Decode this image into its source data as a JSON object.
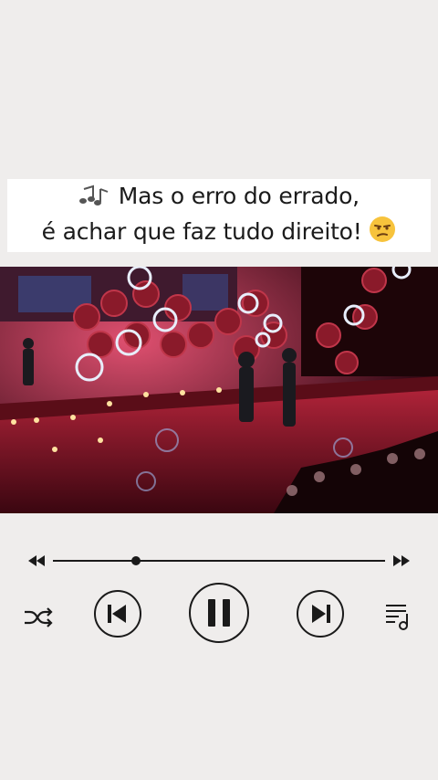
{
  "caption": {
    "line1_text": "Mas o erro do errado,",
    "line2_text": "é achar que faz tudo direito!",
    "icons": [
      "musical-notes-icon",
      "unamused-face-icon"
    ]
  },
  "video": {
    "description_icon": "concert-stage-video"
  },
  "player": {
    "progress_fraction": 0.25,
    "controls": [
      "rewind",
      "shuffle",
      "previous",
      "pause",
      "next",
      "playlist",
      "fast-forward"
    ],
    "colors": {
      "controls": "#1a1a1a",
      "background": "#efedec"
    }
  }
}
